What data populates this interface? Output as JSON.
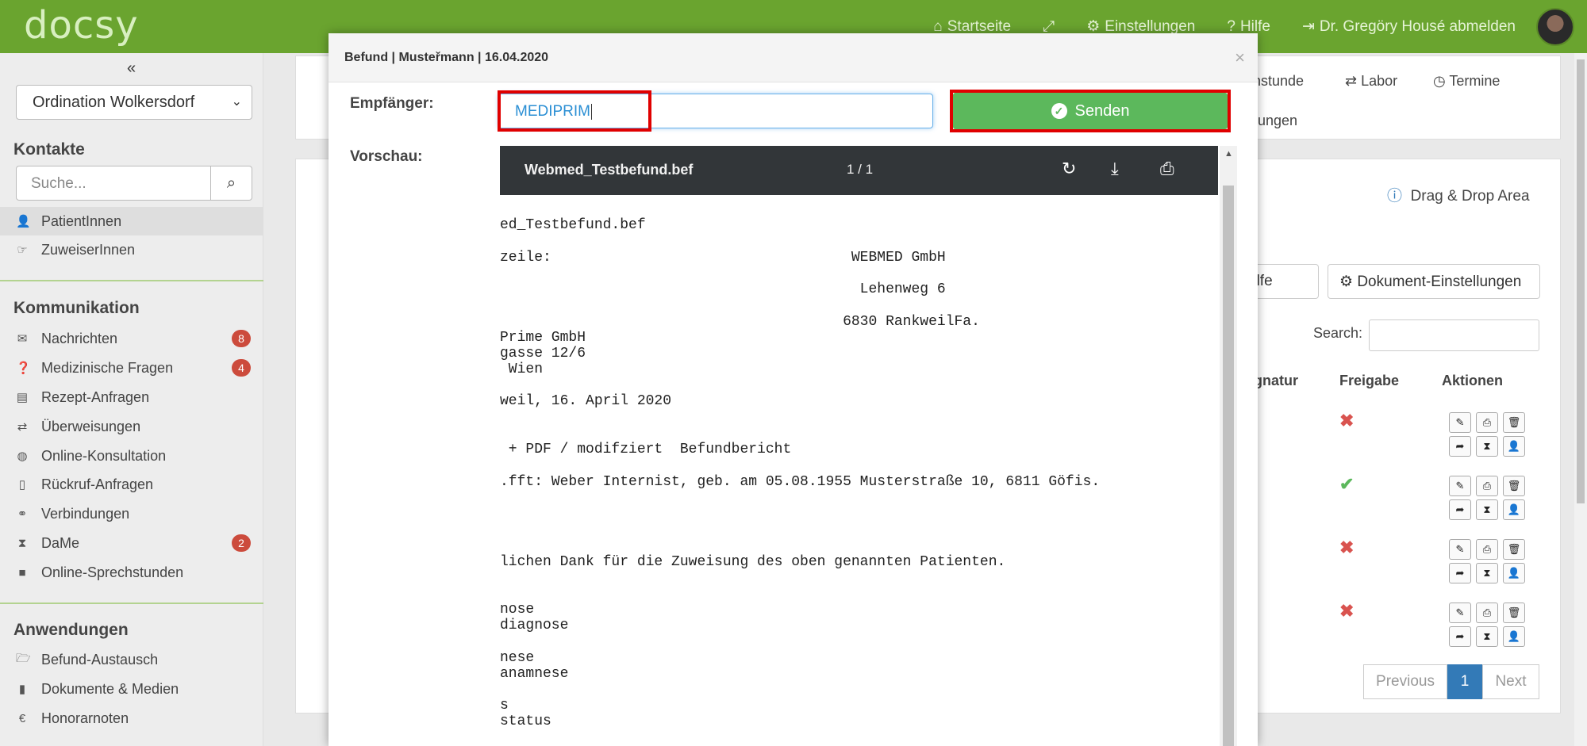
{
  "app": {
    "logo": "docsy",
    "nav": [
      {
        "icon": "home-icon",
        "glyph": "⌂",
        "label": "Startseite"
      },
      {
        "icon": "fullscreen-icon",
        "glyph": "⤢",
        "label": ""
      },
      {
        "icon": "gear-icon",
        "glyph": "⚙",
        "label": "Einstellungen"
      },
      {
        "icon": "help-icon",
        "glyph": "?",
        "label": "Hilfe"
      },
      {
        "icon": "logout-icon",
        "glyph": "⇥",
        "label": "Dr. Gregöry Housé abmelden"
      }
    ]
  },
  "sidebar": {
    "ordination": "Ordination Wolkersdorf",
    "kontakte_title": "Kontakte",
    "search_placeholder": "Suche...",
    "kontakte": [
      {
        "label": "PatientInnen",
        "icon": "user-icon",
        "glyph": "👤"
      },
      {
        "label": "ZuweiserInnen",
        "icon": "pointing-hand-icon",
        "glyph": "☞"
      }
    ],
    "kommunikation_title": "Kommunikation",
    "kommunikation": [
      {
        "label": "Nachrichten",
        "icon": "envelope-icon",
        "glyph": "✉",
        "badge": "8"
      },
      {
        "label": "Medizinische Fragen",
        "icon": "question-circle-icon",
        "glyph": "❓",
        "badge": "4"
      },
      {
        "label": "Rezept-Anfragen",
        "icon": "list-icon",
        "glyph": "▤",
        "badge": ""
      },
      {
        "label": "Überweisungen",
        "icon": "exchange-icon",
        "glyph": "⇄",
        "badge": ""
      },
      {
        "label": "Online-Konsultation",
        "icon": "globe-icon",
        "glyph": "◍",
        "badge": ""
      },
      {
        "label": "Rückruf-Anfragen",
        "icon": "mobile-icon",
        "glyph": "▯",
        "badge": ""
      },
      {
        "label": "Verbindungen",
        "icon": "link-icon",
        "glyph": "⚭",
        "badge": ""
      },
      {
        "label": "DaMe",
        "icon": "hourglass-icon",
        "glyph": "⧗",
        "badge": "2"
      },
      {
        "label": "Online-Sprechstunden",
        "icon": "video-icon",
        "glyph": "■",
        "badge": ""
      }
    ],
    "anwendungen_title": "Anwendungen",
    "anwendungen": [
      {
        "label": "Befund-Austausch",
        "icon": "folder-open-icon",
        "glyph": "🗁"
      },
      {
        "label": "Dokumente & Medien",
        "icon": "file-icon",
        "glyph": "▮"
      },
      {
        "label": "Honorarnoten",
        "icon": "euro-icon",
        "glyph": "€"
      }
    ]
  },
  "background": {
    "tabs_partial": [
      "chstunde",
      "Labor",
      "Termine",
      "ungen"
    ],
    "drag_drop": "Drag & Drop Area",
    "btn_help_partial": "sfüllhilfe",
    "btn_doc_settings": "Dokument-Einstellungen",
    "search_label": "Search:",
    "col_signatur_partial": "gnatur",
    "col_freigabe": "Freigabe",
    "col_aktionen": "Aktionen",
    "freigabe": [
      "x",
      "ok",
      "x",
      "x"
    ],
    "pager_prev": "Previous",
    "pager_page": "1",
    "pager_next": "Next"
  },
  "modal": {
    "title": "Befund | Musteřmann | 16.04.2020",
    "recipient_label": "Empfänger:",
    "recipient_value": "MEDIPRIM",
    "send_label": "Senden",
    "preview_label": "Vorschau:",
    "viewer": {
      "filename": "Webmed_Testbefund.bef",
      "pages": "1 / 1"
    },
    "doc_lines": [
      "ed_Testbefund.bef",
      "zeile:                                   WEBMED GmbH",
      "                                          Lehenweg 6",
      "                                        6830 RankweilFa.",
      "Prime GmbH",
      "gasse 12/6",
      " Wien",
      "weil, 16. April 2020",
      " + PDF / modifziert  Befundbericht",
      ".fft: Weber Internist, geb. am 05.08.1955 Musterstraße 10, 6811 Göfis.",
      "lichen Dank für die Zuweisung des oben genannten Patienten.",
      "nose",
      "diagnose",
      "nese",
      "anamnese",
      "s",
      "status"
    ]
  }
}
